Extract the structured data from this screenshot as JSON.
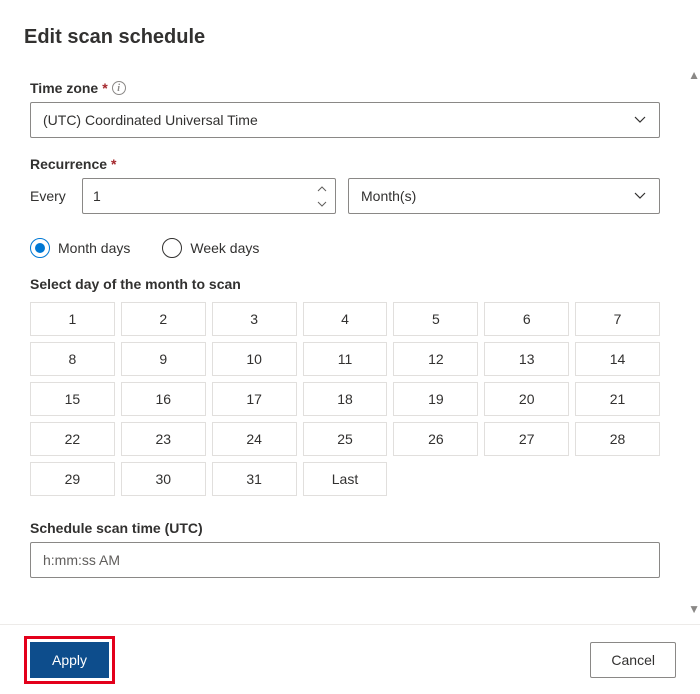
{
  "header": {
    "title": "Edit scan schedule"
  },
  "timezone": {
    "label": "Time zone",
    "required_marker": "*",
    "value": "(UTC) Coordinated Universal Time"
  },
  "recurrence": {
    "label": "Recurrence",
    "required_marker": "*",
    "every_label": "Every",
    "every_value": "1",
    "interval_value": "Month(s)"
  },
  "day_mode": {
    "options": [
      {
        "label": "Month days",
        "selected": true
      },
      {
        "label": "Week days",
        "selected": false
      }
    ]
  },
  "day_picker": {
    "subtitle": "Select day of the month to scan",
    "days": [
      "1",
      "2",
      "3",
      "4",
      "5",
      "6",
      "7",
      "8",
      "9",
      "10",
      "11",
      "12",
      "13",
      "14",
      "15",
      "16",
      "17",
      "18",
      "19",
      "20",
      "21",
      "22",
      "23",
      "24",
      "25",
      "26",
      "27",
      "28",
      "29",
      "30",
      "31",
      "Last"
    ]
  },
  "schedule_time": {
    "label": "Schedule scan time (UTC)",
    "placeholder": "h:mm:ss AM"
  },
  "footer": {
    "apply_label": "Apply",
    "cancel_label": "Cancel"
  },
  "colors": {
    "accent": "#0078d4",
    "primary_btn": "#0d4d8c",
    "highlight_border": "#e3001b"
  }
}
